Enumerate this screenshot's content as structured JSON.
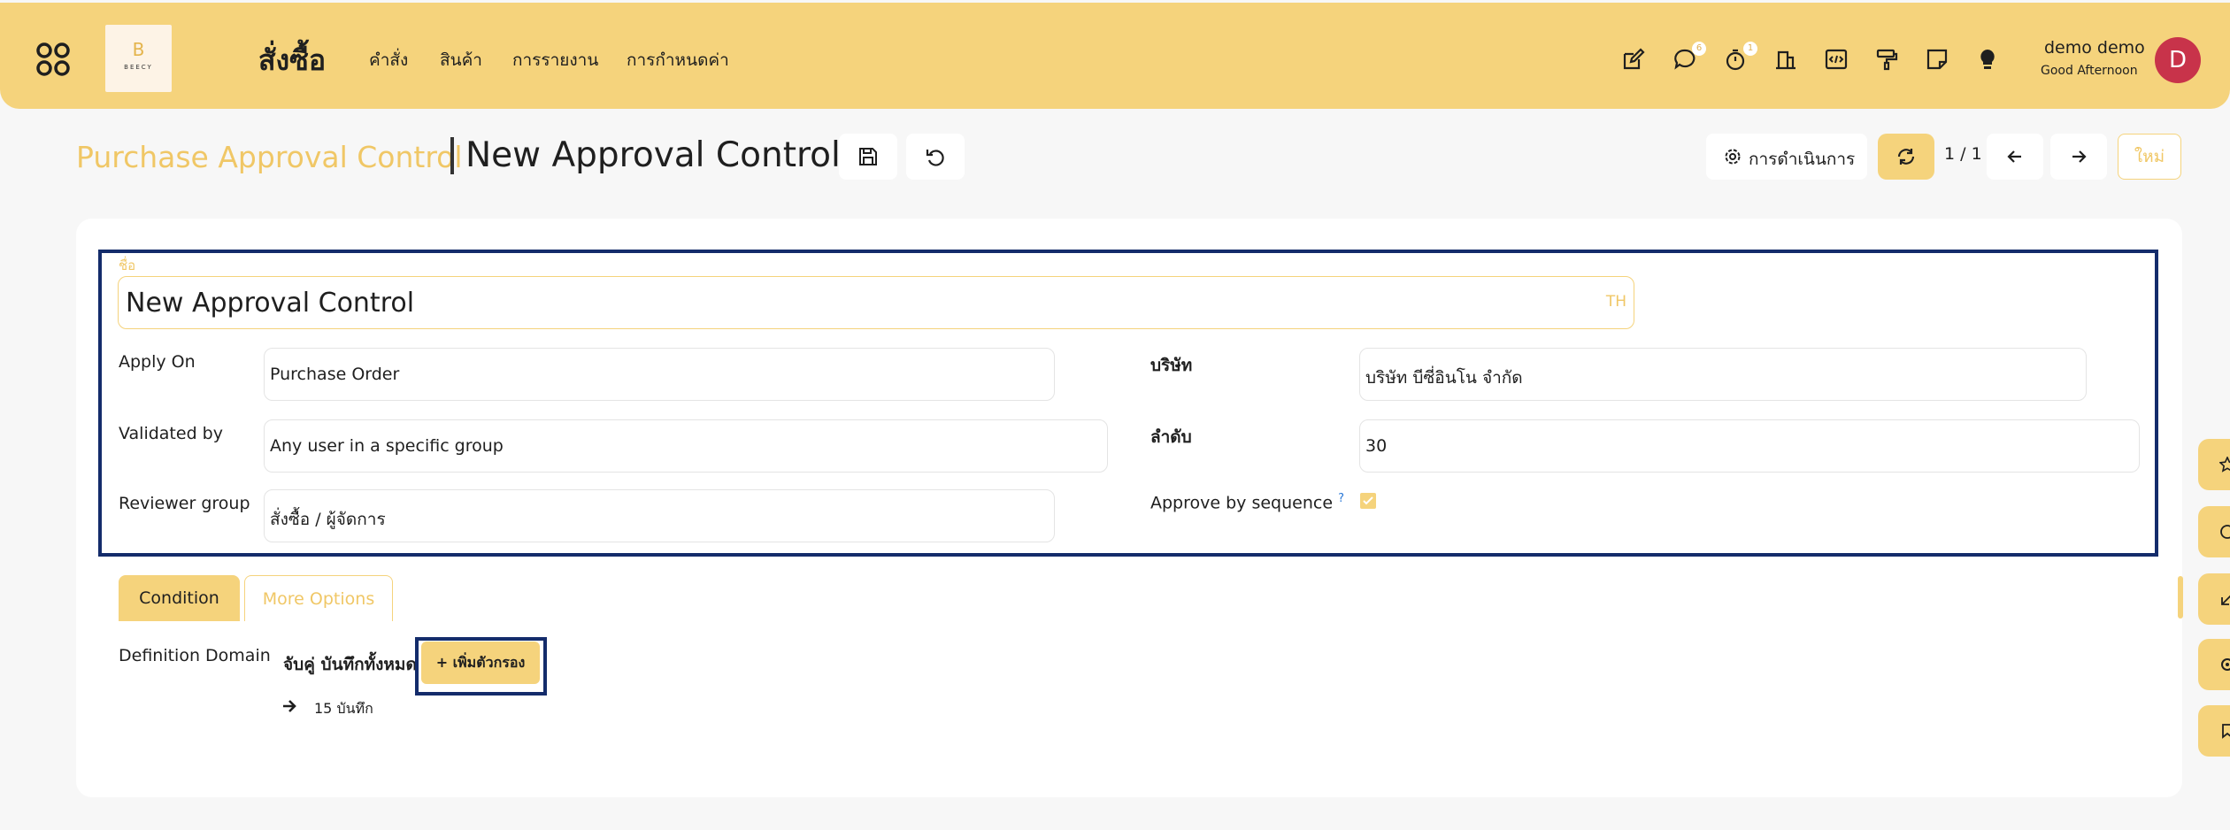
{
  "app": {
    "title": "สั่งซื้อ",
    "logo_text": "BEECY",
    "logo_letter": "B"
  },
  "menu": [
    {
      "label": "คำสั่ง"
    },
    {
      "label": "สินค้า"
    },
    {
      "label": "การรายงาน"
    },
    {
      "label": "การกำหนดค่า"
    }
  ],
  "systray": {
    "messages_badge": "6",
    "activity_badge": "1"
  },
  "user": {
    "name": "demo demo",
    "greeting": "Good Afternoon",
    "avatar_letter": "D"
  },
  "breadcrumb": {
    "parent": "Purchase Approval Control",
    "current": "New Approval Control"
  },
  "control_panel": {
    "action_label": "การดำเนินการ",
    "pager": "1 / 1",
    "new_label": "ใหม่"
  },
  "form": {
    "name_label": "ชื่อ",
    "name_value": "New Approval Control",
    "lang_code": "TH",
    "apply_on_label": "Apply On",
    "apply_on_value": "Purchase Order",
    "validated_by_label": "Validated by",
    "validated_by_value": "Any user in a specific group",
    "reviewer_group_label": "Reviewer group",
    "reviewer_group_value": "สั่งซื้อ / ผู้จัดการ",
    "company_label": "บริษัท",
    "company_value": "บริษัท บีซี่อินโน จำกัด",
    "sequence_label": "ลำดับ",
    "sequence_value": "30",
    "approve_by_sequence_label": "Approve by sequence",
    "approve_by_sequence_help": "?",
    "approve_by_sequence_checked": true
  },
  "tabs": [
    {
      "label": "Condition",
      "active": true
    },
    {
      "label": "More Options",
      "active": false
    }
  ],
  "domain": {
    "label": "Definition Domain",
    "match_text": "จับคู่ บันทึกทั้งหมด",
    "add_filter_label": "+ เพิ่มตัวกรอง",
    "record_count": "15 บันทึก"
  },
  "colors": {
    "accent": "#f5d37c",
    "accent_text": "#f0c766",
    "highlight_border": "#142c6b",
    "avatar": "#c8334a"
  }
}
